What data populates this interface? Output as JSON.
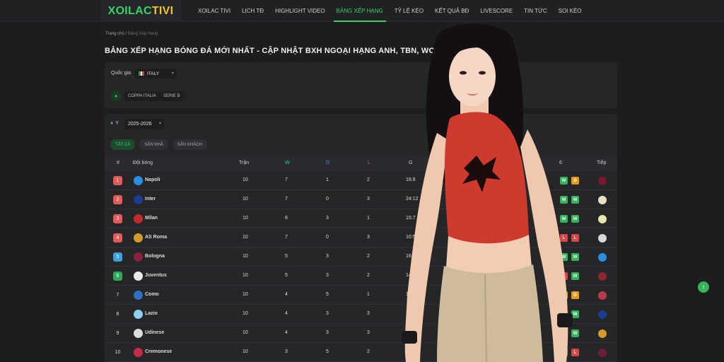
{
  "logo": {
    "text_a": "XOILAC",
    "text_b": "TIVI"
  },
  "nav": [
    "XOILAC TIVI",
    "LỊCH TĐ",
    "HIGHLIGHT VIDEO",
    "BẢNG XẾP HẠNG",
    "TỶ LỆ KÈO",
    "KẾT QUẢ BĐ",
    "LIVESCORE",
    "TIN TỨC",
    "SOI KÈO"
  ],
  "nav_active_index": 3,
  "breadcrumb": {
    "home": "Trang chủ /",
    "current": "Bảng Xếp Hạng"
  },
  "page_title": "BẢNG XẾP HẠNG BÓNG ĐÁ MỚI NHẤT - CẬP NHẬT BXH NGOẠI HẠNG ANH, TBN, WC, C1",
  "filter": {
    "country_label": "Quốc gia",
    "country_value": "ITALY",
    "leagues": [
      "COPPA ITALIA",
      "SERIE B"
    ]
  },
  "season": {
    "value": "2025-2026"
  },
  "tabs": [
    "TẤT CẢ",
    "SÂN NHÀ",
    "SÂN KHÁCH"
  ],
  "table": {
    "headers": {
      "rank": "#",
      "team": "Đội bóng",
      "played": "Trận",
      "w": "W",
      "d": "D",
      "l": "L",
      "g": "G",
      "form_tail": "6",
      "next": "Tiếp"
    },
    "rows": [
      {
        "rank": "1",
        "zone": "cl",
        "team": "Napoli",
        "crest": "#2a8fe0",
        "played": "10",
        "w": "7",
        "d": "1",
        "l": "2",
        "g": "16:8",
        "form": [
          "W",
          "D"
        ],
        "next": "#7a1730"
      },
      {
        "rank": "2",
        "zone": "cl",
        "team": "Inter",
        "crest": "#1c3d8f",
        "played": "10",
        "w": "7",
        "d": "0",
        "l": "3",
        "g": "24:12",
        "form": [
          "W",
          "W"
        ],
        "next": "#e8e2c2"
      },
      {
        "rank": "3",
        "zone": "cl",
        "team": "Milan",
        "crest": "#c52a2a",
        "played": "10",
        "w": "6",
        "d": "3",
        "l": "1",
        "g": "15:7",
        "form": [
          "W",
          "W"
        ],
        "next": "#e9e4b0"
      },
      {
        "rank": "4",
        "zone": "cl",
        "team": "AS Roma",
        "crest": "#d39b2a",
        "played": "10",
        "w": "7",
        "d": "0",
        "l": "3",
        "g": "10:5",
        "form": [
          "L",
          "L"
        ],
        "next": "#d8d8d8"
      },
      {
        "rank": "5",
        "zone": "el",
        "team": "Bologna",
        "crest": "#8b2340",
        "played": "10",
        "w": "5",
        "d": "3",
        "l": "2",
        "g": "16:8",
        "form": [
          "W",
          "W"
        ],
        "next": "#2a8fe0"
      },
      {
        "rank": "6",
        "zone": "ecl",
        "team": "Juventus",
        "crest": "#e9e9e9",
        "played": "10",
        "w": "5",
        "d": "3",
        "l": "2",
        "g": "14:",
        "form": [
          "L",
          "W"
        ],
        "next": "#8c2530"
      },
      {
        "rank": "7",
        "zone": "none",
        "team": "Como",
        "crest": "#2e6fc2",
        "played": "10",
        "w": "4",
        "d": "5",
        "l": "1",
        "g": "1",
        "form": [
          "D",
          "D"
        ],
        "next": "#b83a48"
      },
      {
        "rank": "8",
        "zone": "none",
        "team": "Lazio",
        "crest": "#8fcff0",
        "played": "10",
        "w": "4",
        "d": "3",
        "l": "3",
        "g": "",
        "form": [
          "W",
          "W"
        ],
        "next": "#1c3d8f"
      },
      {
        "rank": "9",
        "zone": "none",
        "team": "Udinese",
        "crest": "#dddddd",
        "played": "10",
        "w": "4",
        "d": "3",
        "l": "3",
        "g": "",
        "form": [
          "W",
          "W"
        ],
        "next": "#d39b2a"
      },
      {
        "rank": "10",
        "zone": "none",
        "team": "Cremonese",
        "crest": "#c52a4a",
        "played": "10",
        "w": "3",
        "d": "5",
        "l": "2",
        "g": "",
        "form": [
          "W",
          "L"
        ],
        "next": "#6b1d3a"
      }
    ]
  },
  "colors": {
    "accent": "#37d26a",
    "bg": "#1c1d1f",
    "panel": "#252628"
  }
}
